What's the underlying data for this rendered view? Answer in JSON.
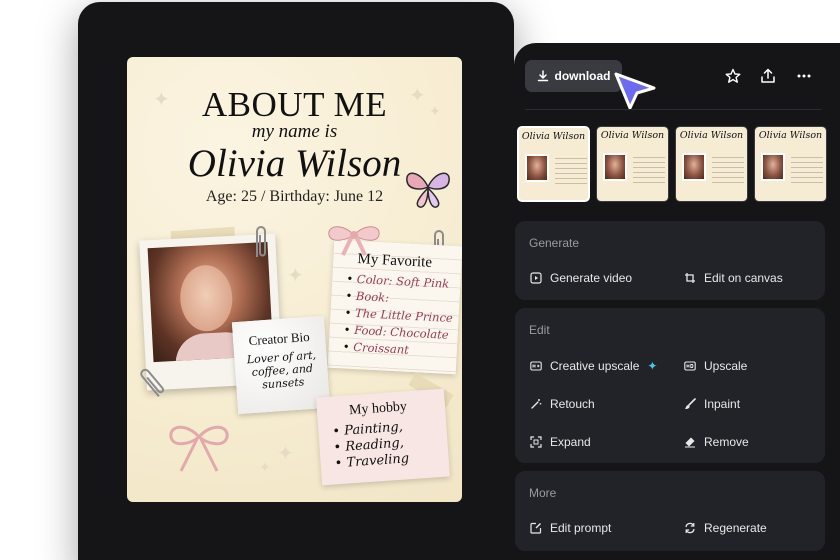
{
  "poster": {
    "title": "ABOUT ME",
    "subtitle": "my name is",
    "name": "Olivia Wilson",
    "age_line": "Age: 25 / Birthday: June 12",
    "favorite": {
      "heading": "My Favorite",
      "items": [
        "Color: Soft Pink",
        "Book:",
        "The Little Prince",
        "Food: Chocolate",
        "Croissant"
      ]
    },
    "bio": {
      "heading": "Creator Bio",
      "text": "Lover of art, coffee, and sunsets"
    },
    "hobby": {
      "heading": "My hobby",
      "items": [
        "Painting,",
        "Reading,",
        "Traveling"
      ]
    }
  },
  "toolbar": {
    "download_label": "download",
    "icons": [
      "star-icon",
      "share-icon",
      "more-icon"
    ]
  },
  "thumbnails": [
    {
      "name": "Olivia Wilson",
      "active": true
    },
    {
      "name": "Olivia Wilson",
      "active": false
    },
    {
      "name": "Olivia Wilson",
      "active": false
    },
    {
      "name": "Olivia Wilson",
      "active": false
    }
  ],
  "sections": {
    "generate": {
      "title": "Generate",
      "actions": [
        "Generate video",
        "Edit on canvas"
      ]
    },
    "edit": {
      "title": "Edit",
      "actions": [
        "Creative upscale",
        "Upscale",
        "Retouch",
        "Inpaint",
        "Expand",
        "Remove"
      ]
    },
    "more": {
      "title": "More",
      "actions": [
        "Edit prompt",
        "Regenerate"
      ]
    }
  },
  "colors": {
    "panel_bg": "#151517",
    "section_bg": "#222328",
    "button_bg": "#3a3b40",
    "cursor_accent": "#6c6af0",
    "spark_accent": "#43c8e8",
    "poster_bg": "#f8efd5",
    "favorite_text": "#9c3a50"
  }
}
